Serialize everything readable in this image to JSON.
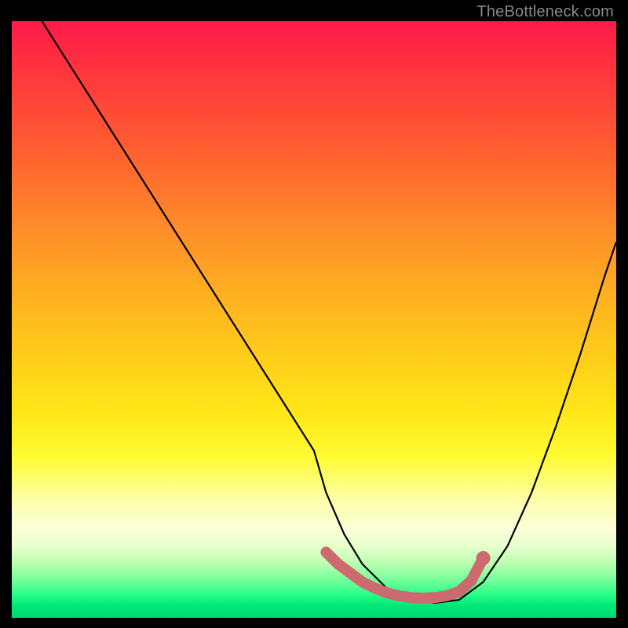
{
  "watermark": "TheBottleneck.com",
  "chart_data": {
    "type": "line",
    "title": "",
    "xlabel": "",
    "ylabel": "",
    "xlim": [
      0,
      100
    ],
    "ylim": [
      0,
      100
    ],
    "series": [
      {
        "name": "curve",
        "x": [
          5,
          10,
          15,
          20,
          25,
          30,
          35,
          40,
          45,
          50,
          52,
          55,
          58,
          62,
          66,
          70,
          74,
          78,
          82,
          86,
          90,
          94,
          98,
          100
        ],
        "values": [
          100,
          92,
          84,
          76,
          68,
          60,
          52,
          44,
          36,
          28,
          21,
          14,
          9,
          5,
          3,
          2.5,
          3,
          6,
          12,
          21,
          32,
          44,
          57,
          63
        ]
      },
      {
        "name": "highlight-dots",
        "x": [
          52,
          54,
          56,
          58,
          60,
          62,
          64,
          66,
          68,
          70,
          72,
          74,
          76,
          78
        ],
        "values": [
          11,
          9,
          7.5,
          6,
          5,
          4.2,
          3.7,
          3.4,
          3.3,
          3.4,
          3.7,
          4.4,
          6.2,
          10
        ]
      }
    ],
    "gradient_stops": [
      {
        "pos": 0,
        "color": "#ff1a4a"
      },
      {
        "pos": 46,
        "color": "#ffd21a"
      },
      {
        "pos": 80,
        "color": "#feffa6"
      },
      {
        "pos": 100,
        "color": "#00d870"
      }
    ]
  }
}
